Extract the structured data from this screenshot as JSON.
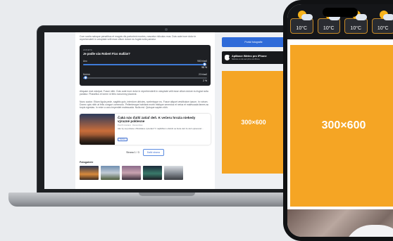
{
  "laptop": {
    "intro_text": "Cum sociis natoque penatibus et magnis dis parturient montes, nascetur ridiculus mus. Duis aute irure dolor in reprehenderit in voluptate velit esse cillum dolore eu fugiat nulla pariatur.",
    "poll": {
      "tag": "ANKETA",
      "question": "Je podle vás Robert Fico mafián?",
      "options": [
        {
          "label": "Ano",
          "votes": "980 hlasů",
          "percent": "98 %",
          "fraction": 0.98
        },
        {
          "label": "Možná",
          "votes": "20 hlasů",
          "percent": "2 %",
          "fraction": 0.02
        }
      ]
    },
    "paragraph_1": "Aliquam erat volutpat. Fusce nibh. Duis aute irure dolor in reprehenderit in voluptate velit esse cillum dolore eu fugiat nulla pariatur. Phasellus et lorem id felis nonummy placerat.",
    "paragraph_2": "Nunc auctor. Etiam ligula pede, sagittis quis, interdum ultricies, scelerisque eu. Fusce aliquet vestibulum ipsum. In rutrum. Donec quis nibh at felis congue commodo. Pellentesque habitant morbi tristique senectus et netus et malesuada fames ac turpis egestas. In enim a arcu imperdiet malesuada. Nulla est. Quisque sapien nibh.",
    "card": {
      "title": "Čaká nás ďalší zatiaľ deň. K večeru hrozia niekedy výrazné poklesne",
      "meta": "Pred 8 minútami · Domovníkov",
      "text": "Ako by sa počasie v Bratislave vyzeralo? V najbližšom období sa bude deň čo deň upravovať...",
      "tag": "Správy"
    },
    "pager": {
      "label": "Strana 1 / 3",
      "next": "Další strana"
    },
    "gallery_title": "Fotogalerie",
    "sidebar_button": "Portál fotografie",
    "app": {
      "title": "Aplikace iMeteo pro iPhone",
      "subtitle": "Stáhněte si náš web přímo do iPhonu"
    },
    "ad_label": "300×600"
  },
  "phone": {
    "weather": [
      {
        "temp": "10°C",
        "icon": "sun-cloud-icon"
      },
      {
        "temp": "10°C",
        "icon": "sun-cloud-icon"
      },
      {
        "temp": "10°C",
        "icon": "sun-cloud-icon"
      },
      {
        "temp": "10°C",
        "icon": "sun-cloud-icon"
      }
    ],
    "ad_label": "300×600"
  },
  "colors": {
    "ad": "#f5a524",
    "accent": "#2f6bd9",
    "dark": "#1e2024"
  }
}
